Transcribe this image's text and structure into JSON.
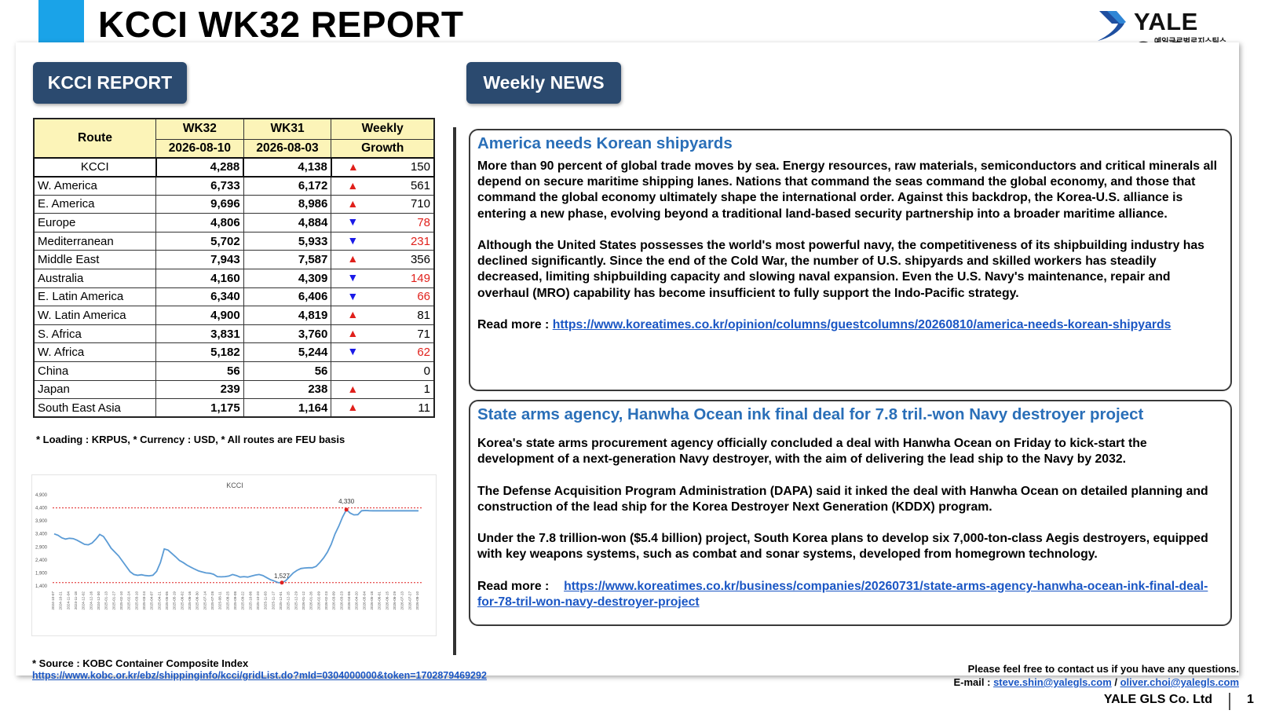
{
  "header": {
    "title": "KCCI WK32 REPORT",
    "logo_name": "YALE GLS",
    "logo_sub": "예일글로벌로지스틱스"
  },
  "sections": {
    "kcci_label": "KCCI REPORT",
    "news_label": "Weekly NEWS"
  },
  "table": {
    "headers": {
      "route": "Route",
      "wk32": "WK32",
      "wk32_date": "2026-08-10",
      "wk31": "WK31",
      "wk31_date": "2026-08-03",
      "growth_1": "Weekly",
      "growth_2": "Growth"
    },
    "rows": [
      {
        "route": "KCCI",
        "wk32": "4,288",
        "wk31": "4,138",
        "dir": "up",
        "change": "150"
      },
      {
        "route": "W. America",
        "wk32": "6,733",
        "wk31": "6,172",
        "dir": "up",
        "change": "561"
      },
      {
        "route": "E. America",
        "wk32": "9,696",
        "wk31": "8,986",
        "dir": "up",
        "change": "710"
      },
      {
        "route": "Europe",
        "wk32": "4,806",
        "wk31": "4,884",
        "dir": "down",
        "change": "78"
      },
      {
        "route": "Mediterranean",
        "wk32": "5,702",
        "wk31": "5,933",
        "dir": "down",
        "change": "231"
      },
      {
        "route": "Middle East",
        "wk32": "7,943",
        "wk31": "7,587",
        "dir": "up",
        "change": "356"
      },
      {
        "route": "Australia",
        "wk32": "4,160",
        "wk31": "4,309",
        "dir": "down",
        "change": "149"
      },
      {
        "route": "E. Latin America",
        "wk32": "6,340",
        "wk31": "6,406",
        "dir": "down",
        "change": "66"
      },
      {
        "route": "W. Latin America",
        "wk32": "4,900",
        "wk31": "4,819",
        "dir": "up",
        "change": "81"
      },
      {
        "route": "S. Africa",
        "wk32": "3,831",
        "wk31": "3,760",
        "dir": "up",
        "change": "71"
      },
      {
        "route": "W. Africa",
        "wk32": "5,182",
        "wk31": "5,244",
        "dir": "down",
        "change": "62"
      },
      {
        "route": "China",
        "wk32": "56",
        "wk31": "56",
        "dir": "none",
        "change": "0"
      },
      {
        "route": "Japan",
        "wk32": "239",
        "wk31": "238",
        "dir": "up",
        "change": "1"
      },
      {
        "route": "South East Asia",
        "wk32": "1,175",
        "wk31": "1,164",
        "dir": "up",
        "change": "11"
      }
    ],
    "footnote": "* Loading :  KRPUS, * Currency : USD, * All routes are FEU basis"
  },
  "chart_data": {
    "type": "line",
    "title": "KCCI",
    "ylim": [
      1400,
      4900
    ],
    "yticks": [
      "4,900",
      "4,400",
      "3,900",
      "3,400",
      "2,900",
      "2,400",
      "1,900",
      "1,400"
    ],
    "y_values": [
      4900,
      4400,
      3900,
      3400,
      2900,
      2400,
      1900,
      1400
    ],
    "max_label": "4,330",
    "min_label": "1,527",
    "max_value": 4330,
    "min_value": 1527,
    "grid": false,
    "x": [
      "2024-10-07",
      "2024-10-14",
      "2024-10-21",
      "2024-10-28",
      "2024-11-04",
      "2024-11-11",
      "2024-11-18",
      "2024-11-25",
      "2024-12-02",
      "2024-12-09",
      "2024-12-16",
      "2024-12-23",
      "2024-12-30",
      "2025-01-06",
      "2025-01-13",
      "2025-01-20",
      "2025-01-27",
      "2025-02-03",
      "2025-02-10",
      "2025-02-17",
      "2025-02-24",
      "2025-03-03",
      "2025-03-10",
      "2025-03-17",
      "2025-03-24",
      "2025-03-31",
      "2025-04-07",
      "2025-04-14",
      "2025-04-21",
      "2025-04-28",
      "2025-05-05",
      "2025-05-12",
      "2025-05-19",
      "2025-05-26",
      "2025-06-02",
      "2025-06-09",
      "2025-06-16",
      "2025-06-23",
      "2025-06-30",
      "2025-07-07",
      "2025-07-14",
      "2025-07-21",
      "2025-07-28",
      "2025-08-04",
      "2025-08-11",
      "2025-08-18",
      "2025-08-25",
      "2025-09-01",
      "2025-09-08",
      "2025-09-15",
      "2025-09-22",
      "2025-09-29",
      "2025-10-06",
      "2025-10-13",
      "2025-10-20",
      "2025-10-27",
      "2025-11-03",
      "2025-11-10",
      "2025-11-17",
      "2025-11-24",
      "2025-12-01",
      "2025-12-08",
      "2025-12-15",
      "2025-12-22",
      "2025-12-29",
      "2026-01-05",
      "2026-01-12",
      "2026-01-19",
      "2026-01-26",
      "2026-02-02",
      "2026-02-09",
      "2026-02-16",
      "2026-02-23",
      "2026-03-02",
      "2026-03-09",
      "2026-03-16",
      "2026-03-23",
      "2026-03-30",
      "2026-04-06",
      "2026-04-13",
      "2026-04-20",
      "2026-04-27",
      "2026-05-04",
      "2026-05-11",
      "2026-05-18",
      "2026-05-25",
      "2026-06-01",
      "2026-06-08",
      "2026-06-15",
      "2026-06-22",
      "2026-06-29",
      "2026-07-06",
      "2026-07-13",
      "2026-07-20",
      "2026-07-27",
      "2026-08-03",
      "2026-08-10"
    ],
    "x_labels": [
      "2024-10-07",
      "2024-10-21",
      "2024-11-04",
      "2024-11-18",
      "2024-12-02",
      "2024-12-16",
      "2024-12-30",
      "2025-01-13",
      "2025-01-27",
      "2025-02-10",
      "2025-02-24",
      "2025-03-10",
      "2025-03-24",
      "2025-04-07",
      "2025-04-21",
      "2025-05-05",
      "2025-05-19",
      "2025-06-02",
      "2025-06-16",
      "2025-06-30",
      "2025-07-14",
      "2025-07-28",
      "2025-08-11",
      "2025-08-25",
      "2025-09-08",
      "2025-09-22",
      "2025-10-06",
      "2025-10-20",
      "2025-11-03",
      "2025-11-17",
      "2025-12-01",
      "2025-12-15",
      "2025-12-29",
      "2026-01-12",
      "2026-01-26",
      "2026-02-09",
      "2026-02-23",
      "2026-03-09",
      "2026-03-23",
      "2026-04-06",
      "2026-04-20",
      "2026-05-04",
      "2026-05-18",
      "2026-06-01",
      "2026-06-15",
      "2026-06-29",
      "2026-07-13",
      "2026-07-27",
      "2026-08-10"
    ],
    "values": [
      3400,
      3350,
      3250,
      3200,
      3230,
      3220,
      3160,
      3080,
      3000,
      2980,
      3050,
      3200,
      3380,
      3300,
      3080,
      2850,
      2700,
      2550,
      2350,
      2150,
      1950,
      1840,
      1810,
      1830,
      1800,
      1790,
      1810,
      1960,
      2300,
      2820,
      2780,
      2650,
      2520,
      2380,
      2300,
      2200,
      2120,
      2050,
      1980,
      1940,
      1900,
      1890,
      1850,
      1760,
      1750,
      1760,
      1780,
      1840,
      1800,
      1740,
      1760,
      1740,
      1780,
      1820,
      1840,
      1800,
      1720,
      1640,
      1590,
      1530,
      1527,
      1600,
      1750,
      1900,
      2000,
      2070,
      2090,
      2100,
      2100,
      2150,
      2300,
      2480,
      2700,
      3000,
      3400,
      3700,
      4050,
      4330,
      4200,
      4130,
      4140,
      4288,
      4300,
      4290,
      4288,
      4288,
      4288,
      4288,
      4288,
      4288,
      4288,
      4288,
      4288,
      4288,
      4288,
      4288,
      4288
    ],
    "ref_lines": [
      4400,
      1527
    ]
  },
  "source": {
    "label": "* Source : KOBC Container Composite Index",
    "link": "https://www.kobc.or.kr/ebz/shippinginfo/kcci/gridList.do?mId=0304000000&token=1702879469292"
  },
  "news": [
    {
      "title": "America needs Korean shipyards",
      "paragraphs": [
        "More than 90 percent of global trade moves by sea. Energy resources, raw materials, semiconductors and critical minerals all depend on secure maritime shipping lanes. Nations that command the seas command the global economy, and those that command the global economy ultimately shape the international order. Against this backdrop, the Korea-U.S. alliance is entering a new phase, evolving beyond a traditional land-based security partnership into a broader maritime alliance.",
        "Although the United States possesses the world's most powerful navy, the competitiveness of its shipbuilding industry has declined significantly. Since the end of the Cold War, the number of U.S. shipyards and skilled workers has steadily decreased, limiting shipbuilding capacity and slowing naval expansion. Even the U.S. Navy's maintenance, repair and overhaul (MRO) capability has become insufficient to fully support the Indo-Pacific strategy."
      ],
      "readmore_label": "Read more : ",
      "readmore_link": "https://www.koreatimes.co.kr/opinion/columns/guestcolumns/20260810/america-needs-korean-shipyards"
    },
    {
      "title": "State arms agency, Hanwha Ocean ink final deal for 7.8 tril.-won Navy destroyer project",
      "paragraphs": [
        "Korea's state arms procurement agency officially concluded a deal with Hanwha Ocean on Friday to kick-start the development of a next-generation Navy destroyer, with the aim of delivering the lead ship to the Navy by 2032.",
        "The Defense Acquisition Program Administration (DAPA) said it inked the deal with Hanwha Ocean on detailed planning and construction of the lead ship for the Korea Destroyer Next Generation (KDDX) program.",
        "Under the 7.8 trillion-won ($5.4 billion) project, South Korea plans to develop six 7,000-ton-class Aegis destroyers, equipped with key weapons systems, such as combat and sonar systems, developed from homegrown technology."
      ],
      "readmore_label": "Read more : ",
      "readmore_link": "https://www.koreatimes.co.kr/business/companies/20260731/state-arms-agency-hanwha-ocean-ink-final-deal-for-78-tril-won-navy-destroyer-project"
    }
  ],
  "footer": {
    "contact": "Please feel free to contact us if you have any questions.",
    "email_label": "E-mail : ",
    "email1": "steve.shin@yalegls.com",
    "email_sep": " / ",
    "email2": "oliver.choi@yalegls.com",
    "company": "YALE GLS Co. Ltd",
    "page": "1"
  },
  "colors": {
    "accent": "#1aa3e8",
    "button_bg": "#2b4a6f",
    "header_fill": "#fcf4b8",
    "up": "#e0201b",
    "down": "#1a1ae8",
    "news_title": "#2a6fb8",
    "link": "#1a56c4",
    "line": "#5b9bd5"
  }
}
